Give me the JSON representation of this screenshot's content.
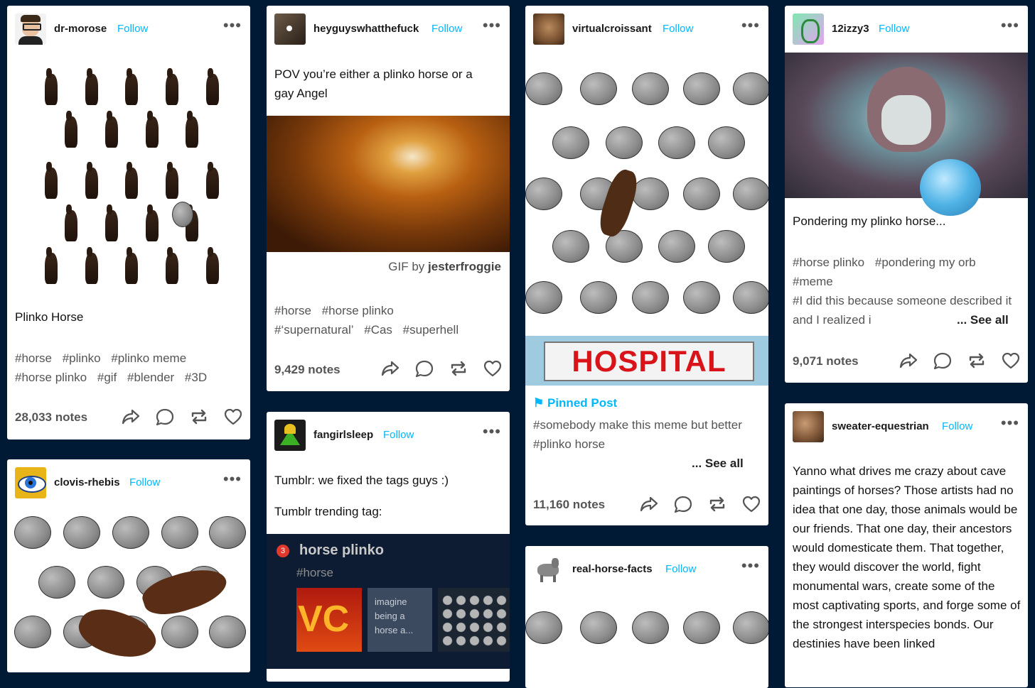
{
  "icons": {
    "share": "share-icon",
    "reply": "reply-icon",
    "reblog": "reblog-icon",
    "like": "heart-icon",
    "more": "more-dots-icon",
    "pin": "pin-icon"
  },
  "colors": {
    "background": "#001935",
    "follow": "#00b8ff",
    "trend_rank": "#e0392b"
  },
  "posts": [
    {
      "username": "dr-morose",
      "follow": "Follow",
      "more": "•••",
      "text": "Plinko Horse",
      "tags": [
        "#horse",
        "#plinko",
        "#plinko meme",
        "#horse plinko",
        "#gif",
        "#blender",
        "#3D"
      ],
      "notes": "28,033 notes"
    },
    {
      "username": "clovis-rhebis",
      "follow": "Follow",
      "more": "•••"
    },
    {
      "username": "heyguyswhatthefuck",
      "follow": "Follow",
      "more": "•••",
      "text": "POV you’re either a plinko horse or a gay Angel",
      "gif_by": "GIF by",
      "gif_author": "jesterfroggie",
      "tags": [
        "#horse",
        "#horse plinko",
        "#‘supernatural’",
        "#Cas",
        "#superhell"
      ],
      "notes": "9,429 notes"
    },
    {
      "username": "fangirlsleep",
      "follow": "Follow",
      "more": "•••",
      "line1": "Tumblr: we fixed the tags guys :)",
      "line2": "Tumblr trending tag:",
      "trend_rank": "3",
      "trend_title": "horse plinko",
      "trend_tag": "#horse",
      "trend_thumb_text": "imagine being a horse a...",
      "trend_thumb_letters": "VC"
    },
    {
      "username": "virtualcroissant",
      "follow": "Follow",
      "more": "•••",
      "hospital": "HOSPITAL",
      "pinned": "Pinned Post",
      "tags": [
        "#somebody make this meme but better",
        "#plinko horse"
      ],
      "see_all": "... See all",
      "notes": "11,160 notes"
    },
    {
      "username": "real-horse-facts",
      "follow": "Follow",
      "more": "•••"
    },
    {
      "username": "12izzy3",
      "follow": "Follow",
      "more": "•••",
      "text": "Pondering my plinko horse...",
      "tags": [
        "#horse plinko",
        "#pondering my orb",
        "#meme",
        "#I did this because someone described it and I realized i"
      ],
      "see_all": "... See all",
      "notes": "9,071 notes"
    },
    {
      "username": "sweater-equestrian",
      "follow": "Follow",
      "more": "•••",
      "text": "Yanno what drives me crazy about cave paintings of horses? Those artists had no idea that one day, those animals would be our friends. That one day, their ancestors would domesticate them. That together, they would discover the world, fight monumental wars, create some of the most captivating sports, and forge some of the strongest interspecies bonds. Our destinies have been linked"
    }
  ]
}
